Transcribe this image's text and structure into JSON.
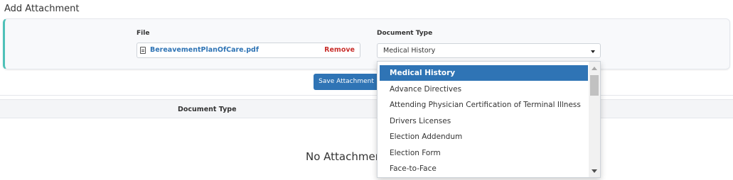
{
  "page": {
    "title": "Add Attachment"
  },
  "form": {
    "file_label": "File",
    "file_name": "BereavementPlanOfCare.pdf",
    "remove_label": "Remove",
    "doc_type_label": "Document Type",
    "doc_type_value": "Medical History",
    "save_label": "Save Attachment"
  },
  "table": {
    "columns": [
      "Document Type"
    ],
    "empty_message": "No Attachments"
  },
  "dropdown": {
    "selected_index": 0,
    "options": [
      "Medical History",
      "Advance Directives",
      "Attending Physician Certification of Terminal Illness",
      "Drivers Licenses",
      "Election Addendum",
      "Election Form",
      "Face-to-Face"
    ]
  },
  "colors": {
    "accent": "#2f74b5",
    "remove": "#c9302c",
    "card_border": "#4fc1b8"
  },
  "icons": [
    "pdf-file-icon",
    "chevron-down-icon",
    "scroll-up-arrow-icon",
    "scroll-down-arrow-icon"
  ]
}
